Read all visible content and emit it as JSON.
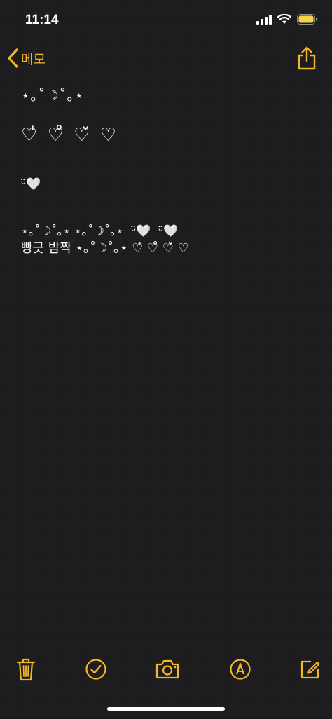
{
  "status_bar": {
    "time": "11:14"
  },
  "nav": {
    "back_label": "메모"
  },
  "note": {
    "lines": [
      "⋆｡˚☽˚｡⋆",
      "♡̍ ♡̊ ♡̌ ♡",
      "ᵕ̈🤍",
      "⋆｡˚☽˚｡⋆ ⋆｡˚☽˚｡⋆  ᵕ̈🤍  ᵕ̈🤍",
      "빵긋 밤짝 ⋆｡˚☽˚｡⋆ ♡̍ ♡̊ ♡̌ ♡"
    ]
  },
  "colors": {
    "accent": "#f4b526",
    "background": "#1c1c1e",
    "text": "#ffffff"
  },
  "icons": {
    "back": "chevron-left-icon",
    "share": "share-icon",
    "trash": "trash-icon",
    "checklist": "checkmark-circle-icon",
    "camera": "camera-icon",
    "markup": "markup-pen-icon",
    "compose": "compose-icon"
  }
}
